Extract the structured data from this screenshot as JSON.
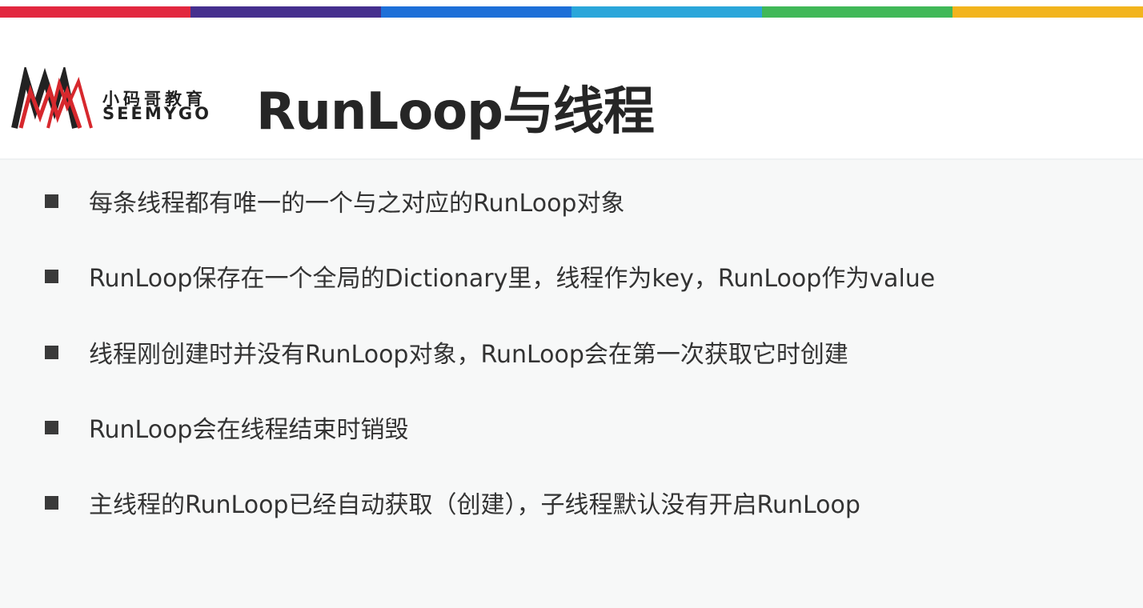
{
  "colors": {
    "bar": [
      "#e2283f",
      "#452f8e",
      "#1d6fd8",
      "#2aa6da",
      "#40b858",
      "#f2b41d"
    ],
    "title": "#262626",
    "body_text": "#333333",
    "bullet_square": "#3a3a3a",
    "logo_red": "#d7282d",
    "logo_dark": "#222222"
  },
  "logo": {
    "name_cn": "小码哥教育",
    "name_en": "SEEMYGO",
    "icon": "seemygo-logo-icon"
  },
  "slide": {
    "title": "RunLoop与线程",
    "bullets": [
      "每条线程都有唯一的一个与之对应的RunLoop对象",
      "RunLoop保存在一个全局的Dictionary里，线程作为key，RunLoop作为value",
      "线程刚创建时并没有RunLoop对象，RunLoop会在第一次获取它时创建",
      "RunLoop会在线程结束时销毁",
      "主线程的RunLoop已经自动获取（创建），子线程默认没有开启RunLoop"
    ]
  }
}
